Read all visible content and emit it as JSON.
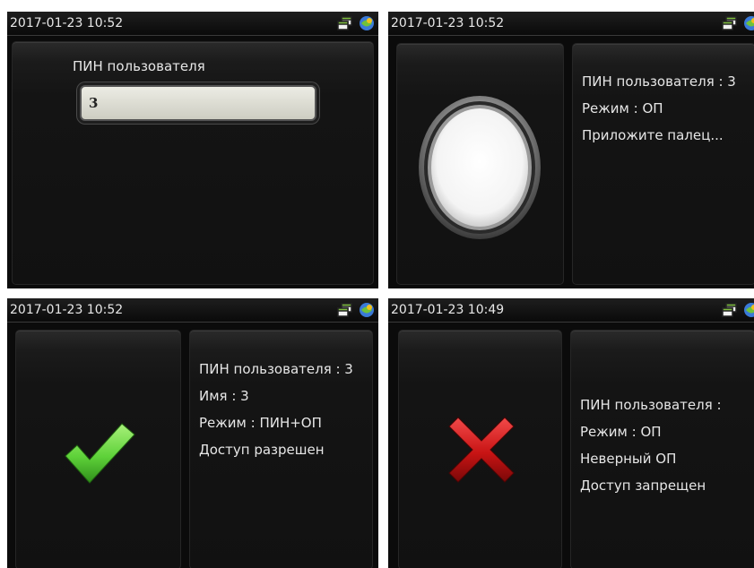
{
  "screens": [
    {
      "status_time": "2017-01-23 10:52",
      "pin_label": "ПИН пользователя",
      "pin_value": "3"
    },
    {
      "status_time": "2017-01-23 10:52",
      "lines": [
        "ПИН пользователя : 3",
        "Режим : ОП",
        "Приложите палец..."
      ],
      "icon": "fingerprint-sensor-icon"
    },
    {
      "status_time": "2017-01-23 10:52",
      "lines": [
        "ПИН пользователя : 3",
        "Имя : 3",
        "Режим : ПИН+ОП",
        "Доступ разрешен"
      ],
      "icon": "checkmark-icon",
      "icon_color": "#5fd23a"
    },
    {
      "status_time": "2017-01-23 10:49",
      "lines": [
        "ПИН пользователя :",
        "Режим : ОП",
        "Неверный ОП",
        "Доступ запрещен"
      ],
      "icon": "cross-icon",
      "icon_color": "#c81414"
    }
  ],
  "status_icons": [
    "network-icon",
    "app-icon"
  ]
}
